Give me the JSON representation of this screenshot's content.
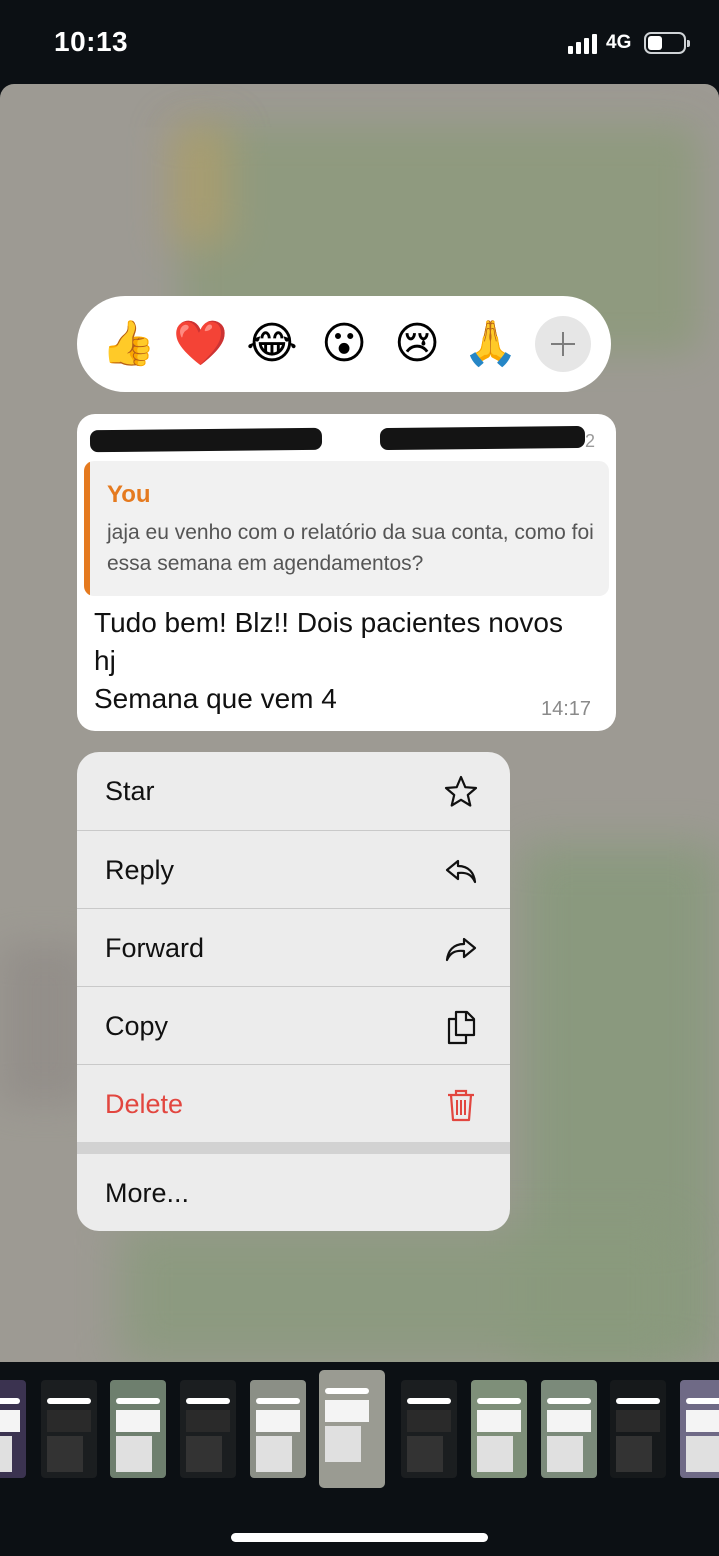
{
  "status_bar": {
    "time": "10:13",
    "network": "4G"
  },
  "reactions": {
    "emojis": [
      "👍",
      "❤️",
      "😂",
      "😮",
      "😢",
      "🙏"
    ],
    "more_icon": "plus-icon"
  },
  "message": {
    "header_tail": "2",
    "quote": {
      "author": "You",
      "text": "jaja eu venho com o relatório da sua conta, como foi essa semana em agendamentos?"
    },
    "text_line1": "Tudo bem! Blz!! Dois pacientes novos",
    "text_line2": "hj",
    "text_line3": "Semana que vem 4",
    "time": "14:17"
  },
  "menu": {
    "items": [
      {
        "label": "Star",
        "icon": "star-icon"
      },
      {
        "label": "Reply",
        "icon": "reply-icon"
      },
      {
        "label": "Forward",
        "icon": "forward-icon"
      },
      {
        "label": "Copy",
        "icon": "copy-icon"
      },
      {
        "label": "Delete",
        "icon": "trash-icon"
      },
      {
        "label": "More..."
      }
    ]
  },
  "colors": {
    "accent_orange": "#e57a1f",
    "danger_red": "#e2463f",
    "background": "#0c1014"
  }
}
